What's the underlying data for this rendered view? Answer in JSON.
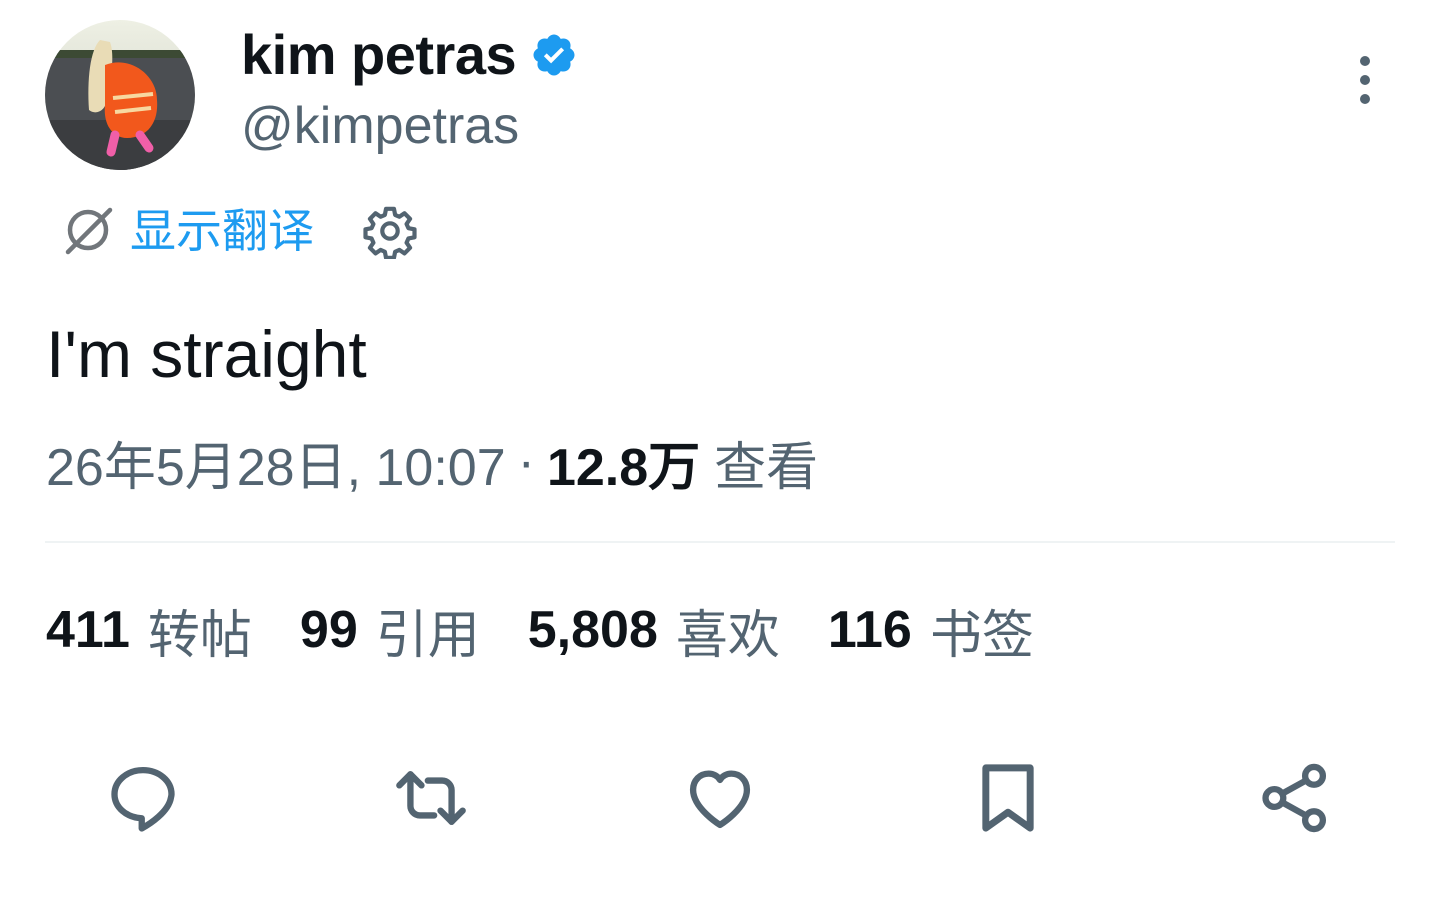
{
  "author": {
    "display_name": "kim petras",
    "handle": "@kimpetras",
    "verified": true,
    "avatar_icon": "profile-photo"
  },
  "translate": {
    "label": "显示翻译"
  },
  "tweet": {
    "text": "I'm straight"
  },
  "meta": {
    "timestamp": "26年5月28日, 10:07",
    "separator": "·",
    "views_count": "12.8万",
    "views_label": "查看"
  },
  "stats": {
    "retweets": {
      "count": "411",
      "label": "转帖"
    },
    "quotes": {
      "count": "99",
      "label": "引用"
    },
    "likes": {
      "count": "5,808",
      "label": "喜欢"
    },
    "bookmarks": {
      "count": "116",
      "label": "书签"
    }
  },
  "actions": [
    "reply-icon",
    "retweet-icon",
    "like-icon",
    "bookmark-icon",
    "share-icon"
  ],
  "colors": {
    "accent": "#1d9bf0",
    "text": "#0f1419",
    "secondary": "#536471",
    "divider": "#eff3f4"
  }
}
